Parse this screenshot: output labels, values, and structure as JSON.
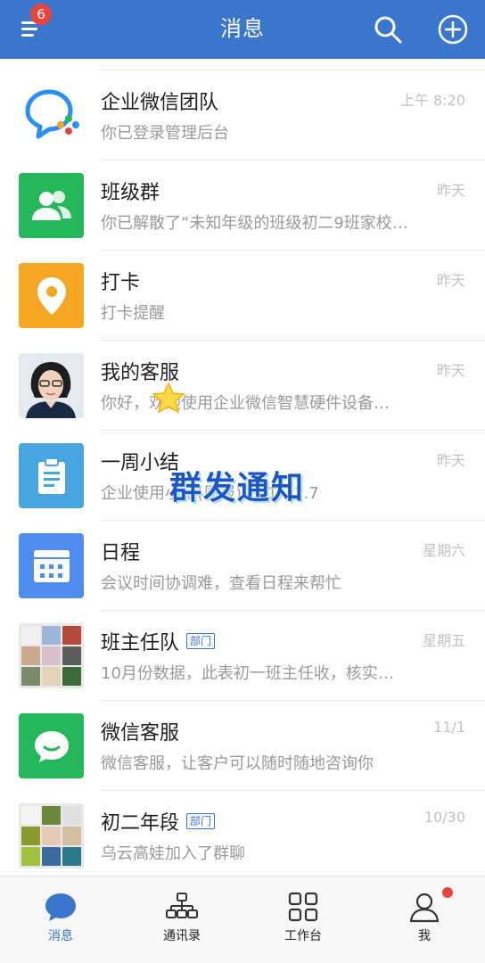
{
  "header": {
    "title": "消息",
    "menu_badge": "6"
  },
  "conversations": [
    {
      "name": "企业微信团队",
      "tag": "",
      "preview": "你已登录管理后台",
      "time": "上午 8:20",
      "avatar": "wecom-logo-icon"
    },
    {
      "name": "班级群",
      "tag": "",
      "preview": "你已解散了“未知年级的班级初二9班家校…",
      "time": "昨天",
      "avatar": "group-icon"
    },
    {
      "name": "打卡",
      "tag": "",
      "preview": "打卡提醒",
      "time": "昨天",
      "avatar": "location-pin-icon"
    },
    {
      "name": "我的客服",
      "tag": "",
      "preview": "你好，欢迎使用企业微信智慧硬件设备…",
      "time": "昨天",
      "avatar": "person-photo"
    },
    {
      "name": "一周小结",
      "tag": "",
      "preview": "企业使用小结(周报)11.1-11.7",
      "time": "昨天",
      "avatar": "clipboard-icon"
    },
    {
      "name": "日程",
      "tag": "",
      "preview": "会议时间协调难，查看日程来帮忙",
      "time": "星期六",
      "avatar": "calendar-icon"
    },
    {
      "name": "班主任队",
      "tag": "部门",
      "preview": "10月份数据，此表初一班主任收，核实…",
      "time": "星期五",
      "avatar": "group-collage"
    },
    {
      "name": "微信客服",
      "tag": "",
      "preview": "微信客服，让客户可以随时随地咨询你",
      "time": "11/1",
      "avatar": "chat-bubble-icon"
    },
    {
      "name": "初二年段",
      "tag": "部门",
      "preview": "乌云高娃加入了群聊",
      "time": "10/30",
      "avatar": "group-collage"
    }
  ],
  "overlay": {
    "text": "群发通知"
  },
  "tabs": [
    {
      "label": "消息",
      "icon": "message-icon",
      "active": true
    },
    {
      "label": "通讯录",
      "icon": "org-chart-icon",
      "active": false
    },
    {
      "label": "工作台",
      "icon": "grid-icon",
      "active": false
    },
    {
      "label": "我",
      "icon": "profile-icon",
      "active": false
    }
  ],
  "colors": {
    "header_bg": "#3a76cc",
    "badge": "#e8453c",
    "green": "#25b85a",
    "orange": "#f5a623",
    "teal_blue": "#47a6e0",
    "calendar_blue": "#4f8ef0"
  }
}
